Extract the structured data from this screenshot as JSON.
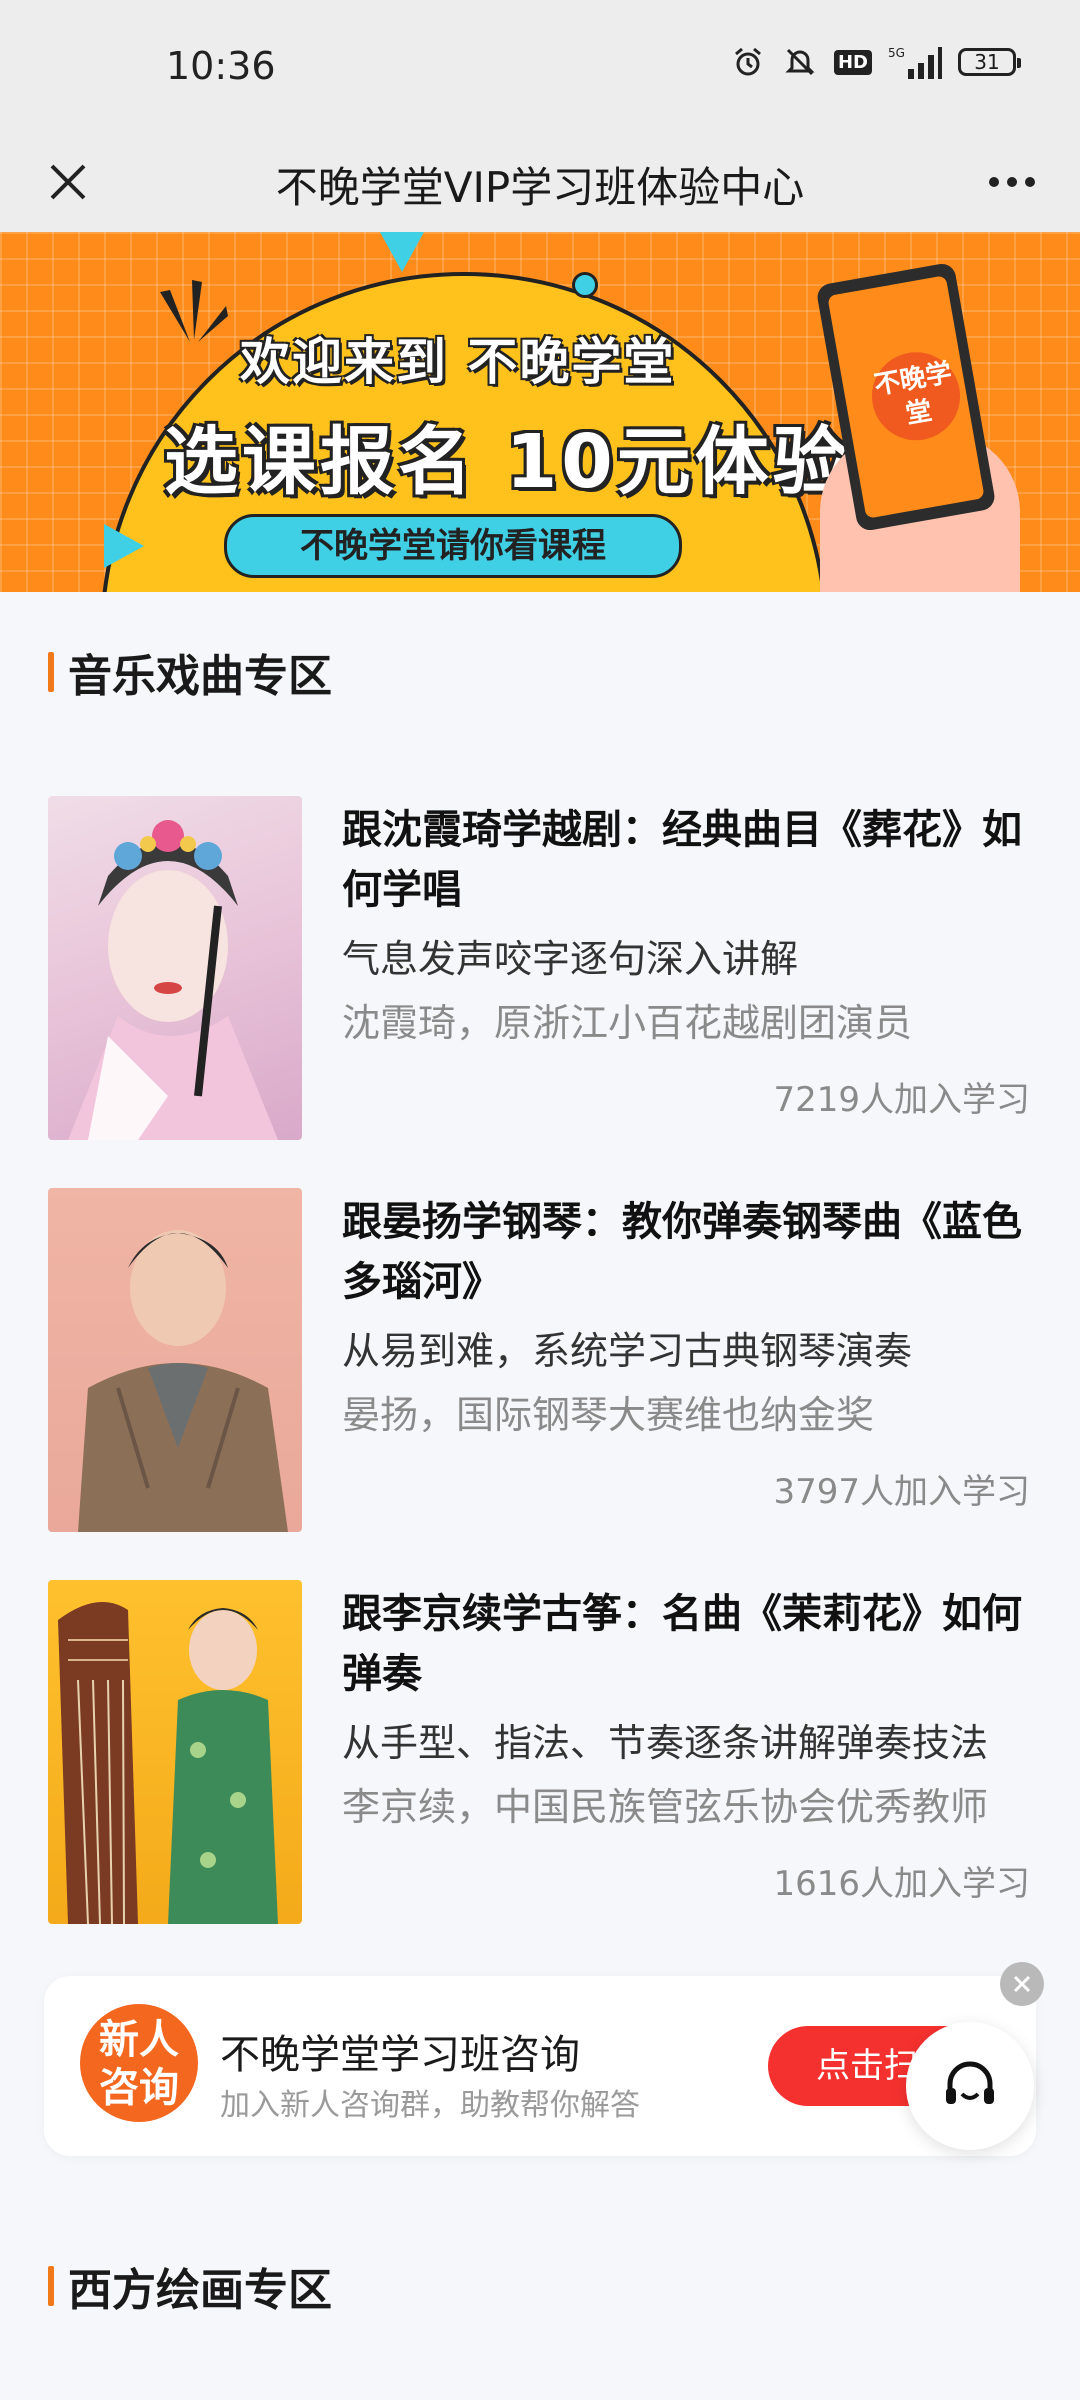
{
  "status_bar": {
    "time": "10:36",
    "hd_badge": "HD",
    "network": "5G",
    "battery": "31"
  },
  "title_bar": {
    "title": "不晚学堂VIP学习班体验中心"
  },
  "banner": {
    "line1": "欢迎来到 不晚学堂",
    "line2": "选课报名 10元体验",
    "pill": "不晚学堂请你看课程",
    "phone_logo": "不晚学堂"
  },
  "sections": [
    {
      "title": "音乐戏曲专区"
    },
    {
      "title": "西方绘画专区"
    }
  ],
  "courses": [
    {
      "title": "跟沈霞琦学越剧：经典曲目《葬花》如何学唱",
      "description": "气息发声咬字逐句深入讲解",
      "teacher": "沈霞琦，原浙江小百花越剧团演员",
      "learners": "7219人加入学习"
    },
    {
      "title": "跟晏扬学钢琴：教你弹奏钢琴曲《蓝色多瑙河》",
      "description": "从易到难，系统学习古典钢琴演奏",
      "teacher": "晏扬，国际钢琴大赛维也纳金奖",
      "learners": "3797人加入学习"
    },
    {
      "title": "跟李京续学古筝：名曲《茉莉花》如何弹奏",
      "description": "从手型、指法、节奏逐条讲解弹奏技法",
      "teacher": "李京续，中国民族管弦乐协会优秀教师",
      "learners": "1616人加入学习"
    }
  ],
  "consult": {
    "badge": "新人咨询",
    "title": "不晚学堂学习班咨询",
    "subtitle": "加入新人咨询群，助教帮你解答",
    "button": "点击扫"
  }
}
